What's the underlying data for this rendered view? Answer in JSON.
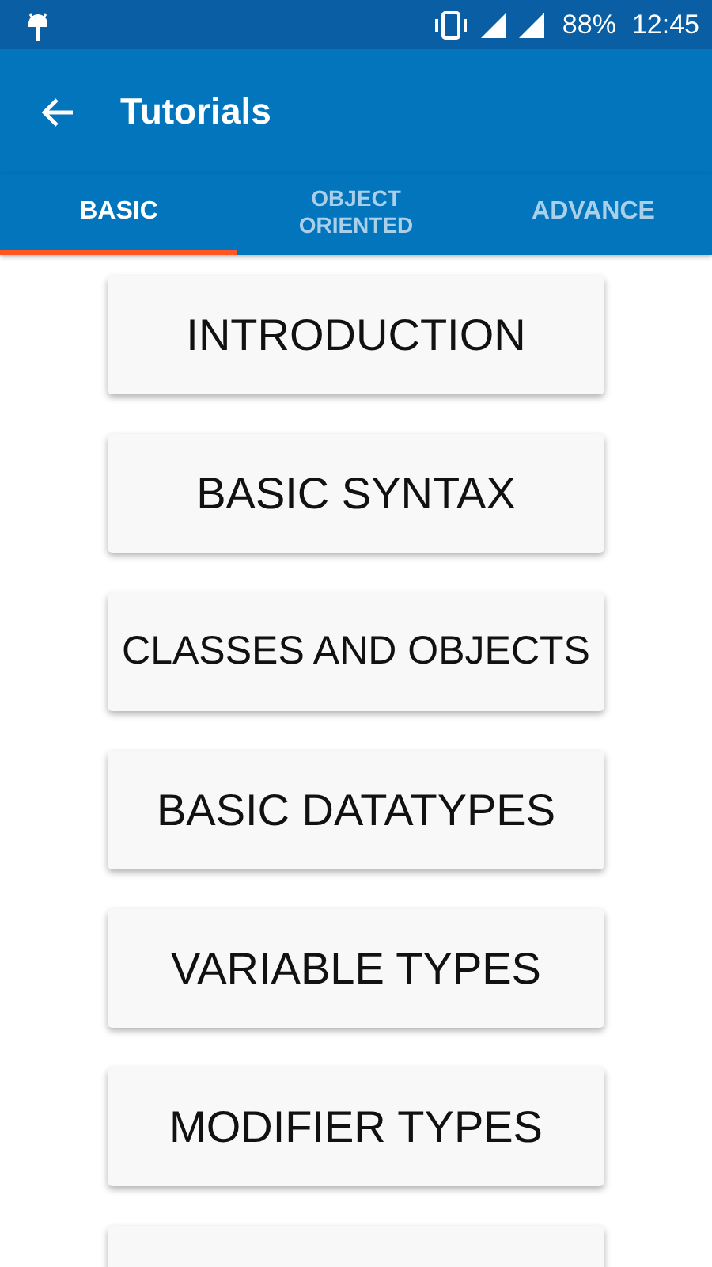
{
  "status_bar": {
    "battery": "88%",
    "time": "12:45"
  },
  "app_bar": {
    "title": "Tutorials"
  },
  "tabs": [
    {
      "label": "BASIC",
      "selected": true
    },
    {
      "label": "OBJECT\nORIENTED",
      "selected": false
    },
    {
      "label": "ADVANCE",
      "selected": false
    }
  ],
  "topics": [
    {
      "kind": "full",
      "label": "INTRODUCTION"
    },
    {
      "kind": "full",
      "label": "BASIC SYNTAX"
    },
    {
      "kind": "full",
      "label": "CLASSES AND OBJECTS"
    },
    {
      "kind": "full",
      "label": "BASIC DATATYPES"
    },
    {
      "kind": "full",
      "label": "VARIABLE TYPES"
    },
    {
      "kind": "full",
      "label": "MODIFIER TYPES"
    },
    {
      "kind": "cut"
    }
  ]
}
